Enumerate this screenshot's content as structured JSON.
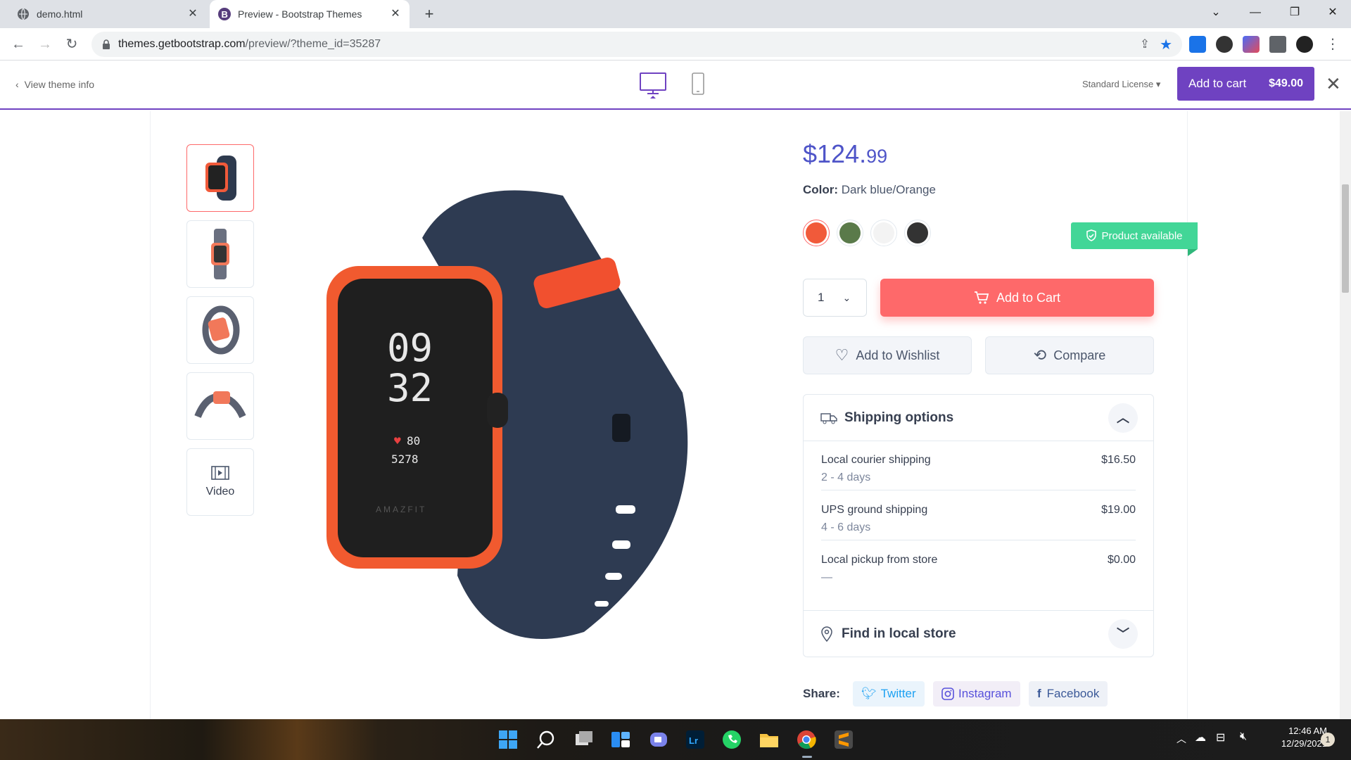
{
  "browser": {
    "tabs": [
      {
        "title": "demo.html"
      },
      {
        "title": "Preview - Bootstrap Themes"
      }
    ],
    "url_host": "themes.getbootstrap.com",
    "url_path": "/preview/?theme_id=35287"
  },
  "preview_bar": {
    "view_theme_info": "View theme info",
    "license": "Standard License",
    "add_to_cart": "Add to cart",
    "cart_price": "$49.00"
  },
  "gallery": {
    "video_label": "Video",
    "watch_time_top": "09",
    "watch_time_bottom": "32",
    "watch_heart": "80",
    "watch_steps": "5278",
    "watch_brand": "AMAZFIT"
  },
  "product": {
    "price_main": "$124.",
    "price_cents": "99",
    "color_label": "Color:",
    "color_value": "Dark blue/Orange",
    "swatches": [
      "#f15a3a",
      "#5a7a4a",
      "#f3f3f3",
      "#333333"
    ],
    "availability": "Product available",
    "quantity": "1",
    "add_to_cart": "Add to Cart",
    "wishlist": "Add to Wishlist",
    "compare": "Compare"
  },
  "shipping": {
    "title": "Shipping options",
    "options": [
      {
        "name": "Local courier shipping",
        "days": "2 - 4 days",
        "price": "$16.50"
      },
      {
        "name": "UPS ground shipping",
        "days": "4 - 6 days",
        "price": "$19.00"
      },
      {
        "name": "Local pickup from store",
        "days": "—",
        "price": "$0.00"
      }
    ],
    "find_store": "Find in local store"
  },
  "share": {
    "label": "Share:",
    "twitter": "Twitter",
    "instagram": "Instagram",
    "facebook": "Facebook"
  },
  "taskbar": {
    "time": "12:46 AM",
    "date": "12/29/2021",
    "notifications": "1"
  },
  "colors": {
    "brand_purple": "#6f42c1",
    "accent_red": "#fe696a",
    "price_blue": "#4e54c8",
    "success_green": "#42d697"
  }
}
